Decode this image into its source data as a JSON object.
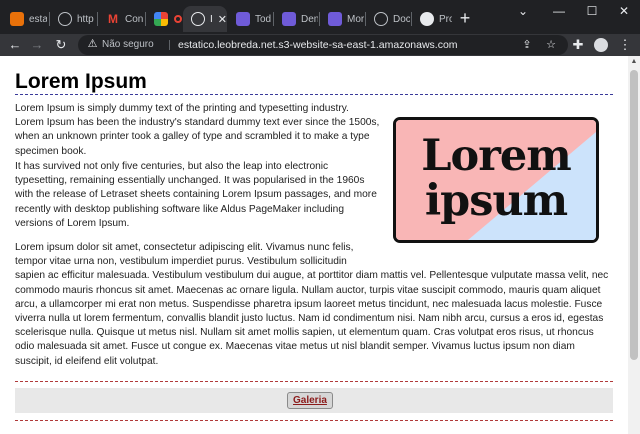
{
  "browser": {
    "tabs": [
      {
        "title": "esta",
        "icon": "orange-box-icon",
        "color": "#e8710a"
      },
      {
        "title": "http",
        "icon": "globe-icon",
        "color": "#5f6368"
      },
      {
        "title": "Con",
        "icon": "gmail-icon",
        "color": "#ea4335"
      },
      {
        "title": "",
        "icon": "multicolor-app-icon",
        "color": "#34a853"
      },
      {
        "title": "I",
        "icon": "globe-icon",
        "color": "#5f6368",
        "active": true
      },
      {
        "title": "Tod",
        "icon": "purple-app-icon",
        "color": "#6f5bd8"
      },
      {
        "title": "Den",
        "icon": "purple-app-icon",
        "color": "#6f5bd8"
      },
      {
        "title": "Mor",
        "icon": "purple-app-icon",
        "color": "#6f5bd8"
      },
      {
        "title": "Doc",
        "icon": "globe-icon",
        "color": "#5f6368"
      },
      {
        "title": "Proj",
        "icon": "github-icon",
        "color": "#ffffff"
      }
    ],
    "new_tab": "+",
    "omnibox": {
      "status": "Não seguro",
      "url": "estatico.leobreda.net.s3-website-sa-east-1.amazonaws.com"
    }
  },
  "page": {
    "title": "Lorem Ipsum",
    "paragraph1": "Lorem Ipsum is simply dummy text of the printing and typesetting industry. Lorem Ipsum has been the industry's standard dummy text ever since the 1500s, when an unknown printer took a galley of type and scrambled it to make a type specimen book.",
    "paragraph2": "It has survived not only five centuries, but also the leap into electronic typesetting, remaining essentially unchanged. It was popularised in the 1960s with the release of Letraset sheets containing Lorem Ipsum passages, and more recently with desktop publishing software like Aldus PageMaker including versions of Lorem Ipsum.",
    "paragraph3_lines": [
      "Lorem ipsum dolor sit amet, consectetur adipiscing elit. Vivamus nunc felis,",
      "tempor vitae urna non, vestibulum imperdiet purus. Vestibulum sollicitudin",
      "sapien ac efficitur malesuada. Vestibulum vestibulum dui augue, at porttitor diam mattis vel. Pellentesque vulputate massa velit, nec",
      "commodo mauris rhoncus sit amet. Maecenas ac ornare ligula. Nullam auctor, turpis vitae suscipit commodo, mauris quam aliquet",
      "arcu, a ullamcorper mi erat non metus. Suspendisse pharetra ipsum laoreet metus tincidunt, nec malesuada lacus molestie. Fusce",
      "viverra nulla ut lorem fermentum, convallis blandit justo luctus. Nam id condimentum nisi. Nam nibh arcu, cursus a eros id, egestas",
      "scelerisque nulla. Quisque ut metus nisl. Nullam sit amet mollis sapien, ut elementum quam. Cras volutpat eros risus, ut rhoncus",
      "odio malesuada sit amet. Fusce ut congue ex. Maecenas vitae metus ut nisl blandit semper. Vivamus luctus ipsum non diam",
      "suscipit, id eleifend elit volutpat."
    ],
    "logo": {
      "line1": "Lorem",
      "line2": "ipsum",
      "colors": {
        "pink": "#f9b6b6",
        "blue": "#cce3fb",
        "ink": "#111111"
      }
    },
    "galeria_label": "Galeria"
  }
}
